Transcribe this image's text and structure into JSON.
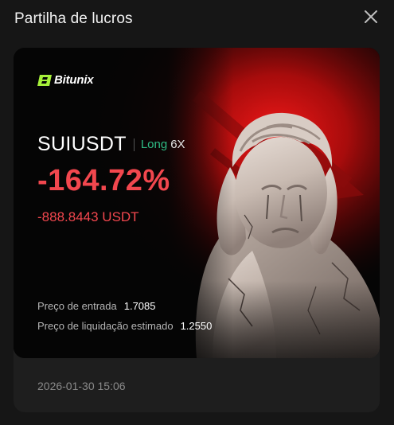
{
  "dialog": {
    "title": "Partilha de lucros",
    "close_icon": "close-icon"
  },
  "card": {
    "brand": "Bitunix",
    "brand_color": "#a6f03a",
    "pair": "SUIUSDT",
    "side": "Long",
    "side_color": "#2fbd85",
    "leverage": "6X",
    "pnl_percent": "-164.72%",
    "pnl_amount": "-888.8443 USDT",
    "loss_color": "#f2474e",
    "entry_label": "Preço de entrada",
    "entry_value": "1.7085",
    "liq_label": "Preço de liquidação estimado",
    "liq_value": "1.2550",
    "illustration": "crying-statue-illustration"
  },
  "footer": {
    "timestamp": "2026-01-30 15:06"
  }
}
